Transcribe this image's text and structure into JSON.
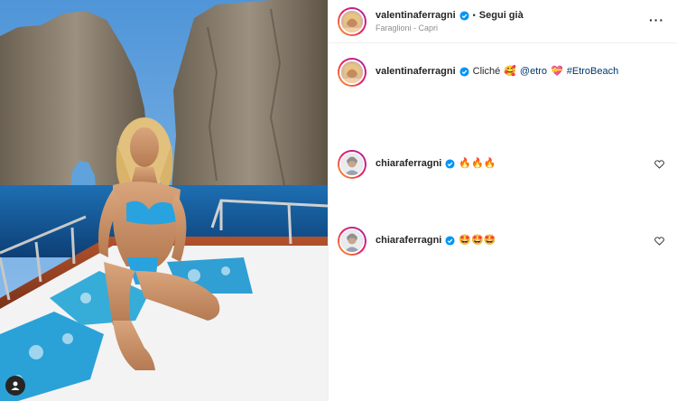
{
  "header": {
    "username": "valentinaferragni",
    "separator": "•",
    "follow_label": "Segui già",
    "location": "Faraglioni - Capri",
    "more": "···"
  },
  "caption": {
    "username": "valentinaferragni",
    "text": "Cliché",
    "emoji1": "🥰",
    "mention": "@etro",
    "emoji2": "💝",
    "hashtag": "#EtroBeach"
  },
  "comments": [
    {
      "username": "chiaraferragni",
      "emojis": "🔥🔥🔥"
    },
    {
      "username": "chiaraferragni",
      "emojis": "🤩🤩🤩"
    }
  ],
  "icons": {
    "verified": "verified-badge-icon",
    "heart": "heart-icon",
    "user_tag": "person-icon"
  },
  "colors": {
    "verified_blue": "#0095f6",
    "link_blue": "#00376b",
    "secondary_text": "#8e8e8e"
  }
}
